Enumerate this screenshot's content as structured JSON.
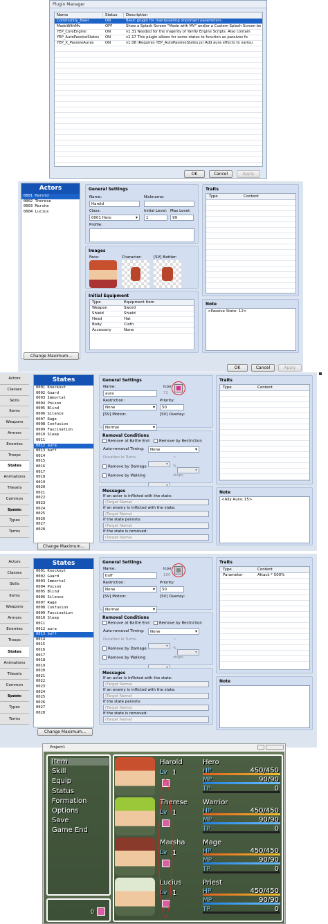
{
  "plugin_manager": {
    "title": "Plugin Manager",
    "columns": [
      "Name",
      "Status",
      "Description"
    ],
    "rows": [
      {
        "name": "Community_Basic",
        "status": "ON",
        "desc": "Basic plugin for manipulating important parameters."
      },
      {
        "name": "MadeWithMv",
        "status": "OFF",
        "desc": "Show a Splash Screen \"Made with MV\" and/or a Custom Splash Screen be"
      },
      {
        "name": "YEP_CoreEngine",
        "status": "ON",
        "desc": "v1.31 Needed for the majority of Yanfly Engine Scripts. Also contain"
      },
      {
        "name": "YEP_AutoPassiveStates",
        "status": "ON",
        "desc": "v1.17 This plugin allows for some states to function as passives fo"
      },
      {
        "name": "YEP_X_PassiveAuras",
        "status": "ON",
        "desc": "v1.08 (Requires YEP_AutoPassiveStates.js) Add aura effects to variou"
      }
    ],
    "ok": "OK",
    "cancel": "Cancel",
    "apply": "Apply"
  },
  "actors": {
    "header": "Actors",
    "list": [
      "0001 Harold",
      "0002 Therese",
      "0003 Marsha",
      "0004 Lucius"
    ],
    "change_max": "Change Maximum...",
    "general": "General Settings",
    "name_label": "Name:",
    "name_value": "Harold",
    "nickname_label": "Nickname:",
    "class_label": "Class:",
    "class_value": "0001 Hero",
    "initial_level_label": "Initial Level:",
    "initial_level": "1",
    "max_level_label": "Max Level:",
    "max_level": "99",
    "profile_label": "Profile:",
    "images": "Images",
    "face_label": "Face:",
    "character_label": "Character:",
    "battler_label": "[SV] Battler:",
    "initial_equipment": "Initial Equipment",
    "equip_cols": [
      "Type",
      "Equipment Item"
    ],
    "equip_rows": [
      [
        "Weapon",
        "Sword"
      ],
      [
        "Shield",
        "Shield"
      ],
      [
        "Head",
        "Hat"
      ],
      [
        "Body",
        "Cloth"
      ],
      [
        "Accessory",
        "None"
      ]
    ],
    "traits": "Traits",
    "traits_cols": [
      "Type",
      "Content"
    ],
    "note": "Note",
    "note_value": "<Passive State: 12>",
    "ok": "OK",
    "cancel": "Cancel",
    "apply": "Apply"
  },
  "tabs1": [
    "Actors",
    "Classes",
    "Skills",
    "Items",
    "Weapons",
    "Armors",
    "Enemies",
    "Troops",
    "States",
    "Animations",
    "Tilesets",
    "Common Events",
    "System",
    "Types",
    "Terms"
  ],
  "tabs1_active": "States",
  "states_list": [
    "0001 Knockout",
    "0002 Guard",
    "0003 Immortal",
    "0004 Poison",
    "0005 Blind",
    "0006 Silence",
    "0007 Rage",
    "0008 Confusion",
    "0009 Fascination",
    "0010 Sleep",
    "0011",
    "0012 aura",
    "0013 buff",
    "0014",
    "0015",
    "0016",
    "0017",
    "0018",
    "0019",
    "0020",
    "0021",
    "0022",
    "0023",
    "0024",
    "0025",
    "0026",
    "0027",
    "0028"
  ],
  "states1": {
    "header": "States",
    "selected_index": 11,
    "general": "General Settings",
    "name_label": "Name:",
    "name_value": "aura",
    "icon_label": "Icon:",
    "icon_num": "72",
    "restriction_label": "Restriction:",
    "restriction": "None",
    "priority_label": "Priority:",
    "priority": "50",
    "motion_label": "[SV] Motion:",
    "motion": "Normal",
    "overlay_label": "[SV] Overlay:",
    "overlay": "None",
    "removal": "Removal Conditions",
    "remove_battle_end": "Remove at Battle End",
    "remove_restriction": "Remove by Restriction",
    "auto_removal_label": "Auto-removal Timing:",
    "auto_removal": "None",
    "duration_label": "Duration in Turns:",
    "tilde": "~",
    "remove_damage": "Remove by Damage",
    "percent": "%",
    "remove_walking": "Remove by Walking",
    "steps": "steps",
    "messages": "Messages",
    "msg_actor": "If an actor is inflicted with the state:",
    "msg_enemy": "If an enemy is inflicted with the state:",
    "msg_persists": "If the state persists:",
    "msg_removed": "If the state is removed:",
    "target_placeholder": "(Target Name)",
    "traits": "Traits",
    "traits_cols": [
      "Type",
      "Content"
    ],
    "note": "Note",
    "note_value": "<Ally Aura: 15>",
    "change_max": "Change Maximum...",
    "ok": "OK",
    "cancel": "Cancel",
    "apply": "Apply"
  },
  "tabs2": [
    "Actors",
    "Classes",
    "Skills",
    "Items",
    "Weapons",
    "Armors",
    "Enemies",
    "Troops",
    "States",
    "Animations",
    "Tilesets",
    "Common Events",
    "System",
    "Types",
    "Terms"
  ],
  "states2": {
    "header": "States",
    "selected_index": 12,
    "name_value": "buff",
    "icon_num": "160",
    "trait_type": "Parameter",
    "trait_content": "Attack * 500%",
    "note_value": "",
    "change_max": "Change Maximum..."
  },
  "game": {
    "window_title": "Project1",
    "menu": [
      "Item",
      "Skill",
      "Equip",
      "Status",
      "Formation",
      "Options",
      "Save",
      "Game End"
    ],
    "gold": "0",
    "lv_label": "Lv",
    "hp_label": "HP",
    "mp_label": "MP",
    "tp_label": "TP",
    "actors": [
      {
        "name": "Harold",
        "cls": "Hero",
        "lv": "1",
        "hp": "450/450",
        "mp": "90/90",
        "tp": "0"
      },
      {
        "name": "Therese",
        "cls": "Warrior",
        "lv": "1",
        "hp": "450/450",
        "mp": "90/90",
        "tp": "0"
      },
      {
        "name": "Marsha",
        "cls": "Mage",
        "lv": "1",
        "hp": "450/450",
        "mp": "90/90",
        "tp": "0"
      },
      {
        "name": "Lucius",
        "cls": "Priest",
        "lv": "1",
        "hp": "450/450",
        "mp": "90/90",
        "tp": "0"
      }
    ]
  }
}
